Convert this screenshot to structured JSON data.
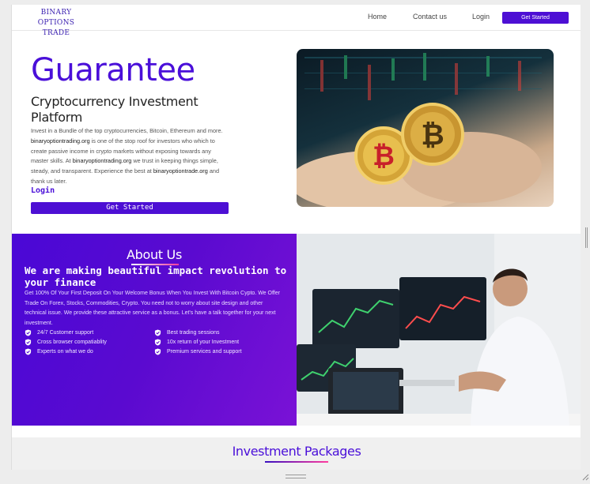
{
  "nav": {
    "logo_line1": "BINARY",
    "logo_line2": "OPTIONS TRADE",
    "links": [
      "Home",
      "Contact us",
      "Login"
    ],
    "cta": "Get Started"
  },
  "hero": {
    "title": "Guarantee",
    "subtitle": "Cryptocurrency Investment Platform",
    "body_1": "Invest in a Bundle of the top cryptocurrencies, Bitcoin, Ethereum and more. ",
    "body_site_1": "binaryoptiontrading.org",
    "body_2": " is one of the stop roof for investors who which to create passive income in crypto markets without exposing towards any master skills. At ",
    "body_site_2": "binaryoptiontrading.org",
    "body_3": " we trust in keeping things simple, steady, and transparent. Experience the best at ",
    "body_site_3": "binaryoptiontrade.org",
    "body_4": " and thank us later.",
    "login": "Login",
    "cta": "Get Started",
    "image": "bitcoin-coins-hands-photo"
  },
  "about": {
    "title": "About Us",
    "headline": "We are making beautiful impact revolution to your finance",
    "body": "Get 100% Of Your First Deposit On Your Welcome Bonus When You Invest With Bitcoin Cypto. We Offer Trade On Forex, Stocks, Commodities, Crypto. You need not to worry about site design and other technical issue. We provide these attractive service as a bonus. Let's have a talk together for your next investment.",
    "features_left": [
      "24/7 Customer support",
      "Cross browser compatiablity",
      "Experts on what we do"
    ],
    "features_right": [
      "Best trading sessions",
      "10x return of your Investment",
      "Premium services and support"
    ],
    "image": "trader-at-desk-photo"
  },
  "packages": {
    "title": "Investment Packages"
  },
  "colors": {
    "brand": "#4d0fd4",
    "accent": "#ff3c9e"
  }
}
